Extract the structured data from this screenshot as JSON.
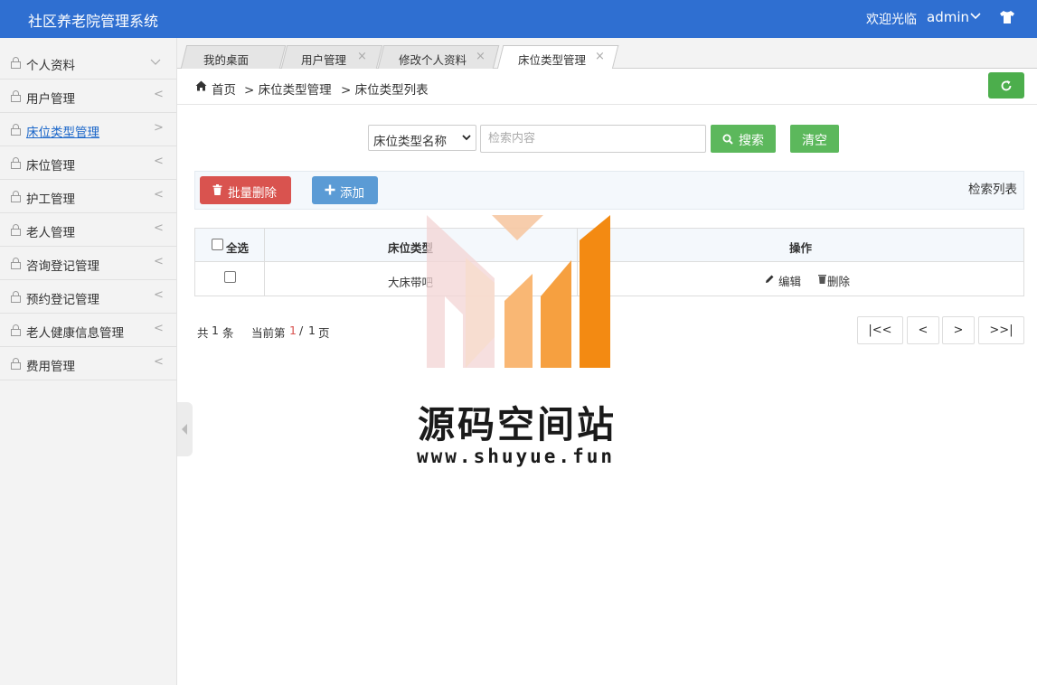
{
  "header": {
    "title": "社区养老院管理系统",
    "welcome": "欢迎光临",
    "user": "admin"
  },
  "sidebar": {
    "items": [
      {
        "label": "个人资料"
      },
      {
        "label": "用户管理"
      },
      {
        "label": "床位类型管理"
      },
      {
        "label": "床位管理"
      },
      {
        "label": "护工管理"
      },
      {
        "label": "老人管理"
      },
      {
        "label": "咨询登记管理"
      },
      {
        "label": "预约登记管理"
      },
      {
        "label": "老人健康信息管理"
      },
      {
        "label": "费用管理"
      }
    ],
    "arrow": "<"
  },
  "tabs": [
    {
      "label": "我的桌面"
    },
    {
      "label": "用户管理"
    },
    {
      "label": "修改个人资料"
    },
    {
      "label": "床位类型管理"
    }
  ],
  "breadcrumb": {
    "home": "首页",
    "level1": "> 床位类型管理",
    "level2": "> 床位类型列表"
  },
  "search": {
    "field_selected": "床位类型名称",
    "placeholder": "检索内容",
    "search_label": "搜索",
    "clear_label": "清空"
  },
  "toolbar": {
    "batch_delete_label": "批量删除",
    "add_label": "添加",
    "list_title": "检索列表"
  },
  "table": {
    "select_all": "全选",
    "columns": [
      "床位类型",
      "操作"
    ],
    "rows": [
      {
        "bed_type": "大床带吧",
        "edit_label": "编辑",
        "delete_label": "删除"
      }
    ]
  },
  "pager": {
    "total_prefix": "共",
    "total": "1",
    "total_suffix": "条",
    "current_prefix": "当前第",
    "current": "1",
    "separator": "/",
    "pages": "1",
    "pages_suffix": "页",
    "first": "|<<",
    "prev": "<",
    "next": ">",
    "last": ">>|"
  },
  "watermark": {
    "title": "源码空间站",
    "url": "www.shuyue.fun"
  },
  "colors": {
    "header_bg": "#2f6fd1",
    "success": "#5cb85c",
    "danger": "#d9534f",
    "primary": "#5b9bd5"
  }
}
